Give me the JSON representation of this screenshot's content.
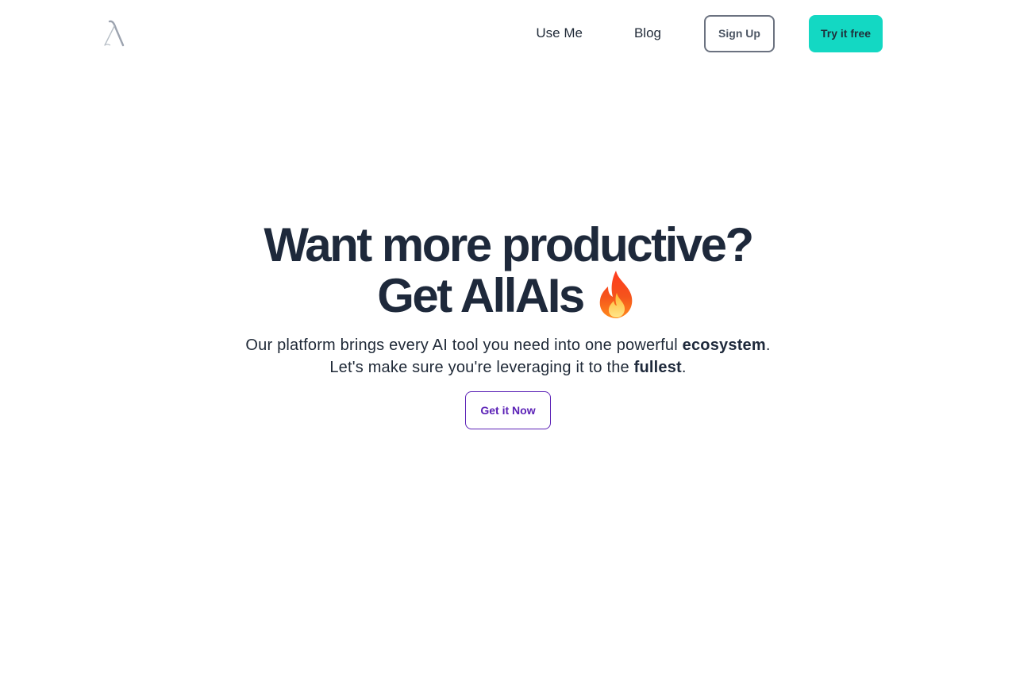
{
  "header": {
    "logo_icon": "lambda-logo-icon",
    "nav": {
      "use_me": "Use Me",
      "blog": "Blog"
    },
    "signup_label": "Sign Up",
    "try_label": "Try it free"
  },
  "hero": {
    "title_line1": "Want more productive?",
    "title_line2": "Get AllAIs",
    "title_icon": "fire-icon",
    "sub_line1_text": "Our platform brings every AI tool you need into one powerful ",
    "sub_line1_bold": "ecosystem",
    "sub_line1_end": ".",
    "sub_line2_text": "Let's make sure you're leveraging it to the ",
    "sub_line2_bold": "fullest",
    "sub_line2_end": ".",
    "cta_label": "Get it Now"
  },
  "colors": {
    "accent_teal": "#13d8c3",
    "accent_purple": "#5b21b6",
    "text_dark": "#1e293b"
  }
}
